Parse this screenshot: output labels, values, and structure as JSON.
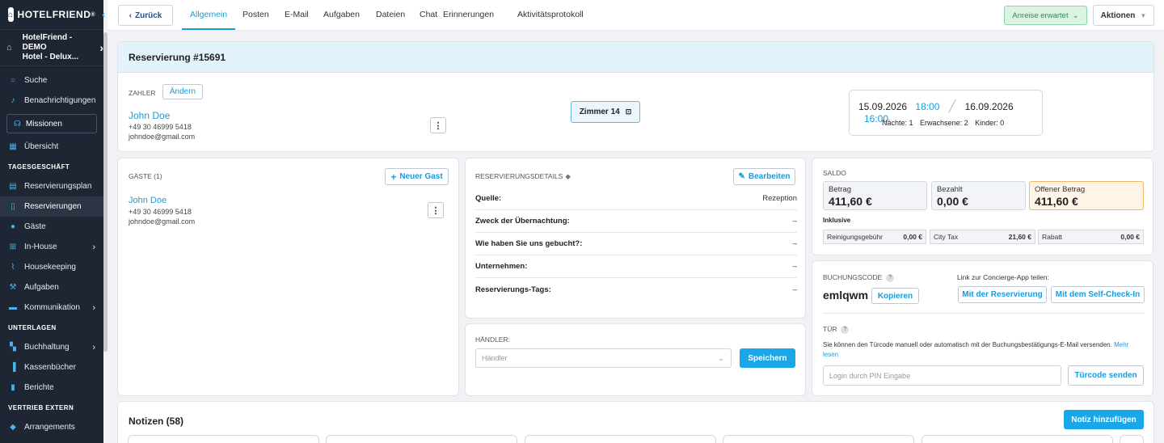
{
  "sidebar": {
    "brand": "HOTELFRIEND",
    "hotel_line1": "HotelFriend - DEMO",
    "hotel_line2": "Hotel - Delux...",
    "search": "Suche",
    "notifications": "Benachrichtigungen",
    "missions": "Missionen",
    "overview": "Übersicht",
    "section_daily": "TAGESGESCHÄFT",
    "reservation_plan": "Reservierungsplan",
    "reservations": "Reservierungen",
    "guests": "Gäste",
    "in_house": "In-House",
    "housekeeping": "Housekeeping",
    "tasks": "Aufgaben",
    "communication": "Kommunikation",
    "section_docs": "UNTERLAGEN",
    "accounting": "Buchhaltung",
    "cashbooks": "Kassenbücher",
    "reports": "Berichte",
    "section_sales": "VERTRIEB EXTERN",
    "arrangements": "Arrangements"
  },
  "topbar": {
    "back": "Zurück",
    "tabs": [
      "Allgemein",
      "Posten",
      "E-Mail",
      "Aufgaben",
      "Dateien",
      "Chat",
      "Erinnerungen",
      "Aktivitätsprotokoll"
    ],
    "status": "Anreise erwartet",
    "actions": "Aktionen"
  },
  "reservation": {
    "title": "Reservierung #15691",
    "payer_label": "ZAHLER",
    "change": "Ändern",
    "payer_name": "John Doe",
    "payer_phone": "+49 30 46999 5418",
    "payer_email": "johndoe@gmail.com",
    "room": "Zimmer 14",
    "arrival_date": "15.09.2026",
    "arrival_time": "18:00",
    "departure_date": "16.09.2026",
    "departure_time": "16:00",
    "nights": "Nächte: 1",
    "adults": "Erwachsene: 2",
    "children": "Kinder: 0"
  },
  "guests": {
    "label": "GÄSTE (1)",
    "new_guest": "Neuer Gast",
    "name": "John Doe",
    "phone": "+49 30 46999 5418",
    "email": "johndoe@gmail.com"
  },
  "details": {
    "label": "RESERVIERUNGSDETAILS",
    "edit": "Bearbeiten",
    "rows": [
      {
        "k": "Quelle:",
        "v": "Rezeption"
      },
      {
        "k": "Zweck der Übernachtung:",
        "v": "–"
      },
      {
        "k": "Wie haben Sie uns gebucht?:",
        "v": "–"
      },
      {
        "k": "Unternehmen:",
        "v": "–"
      },
      {
        "k": "Reservierungs-Tags:",
        "v": "–"
      }
    ]
  },
  "dealer": {
    "label": "HÄNDLER:",
    "placeholder": "Händler",
    "save": "Speichern"
  },
  "balance": {
    "label": "SALDO",
    "amount_label": "Betrag",
    "amount": "411,60 €",
    "paid_label": "Bezahlt",
    "paid": "0,00 €",
    "open_label": "Offener Betrag",
    "open": "411,60 €",
    "inclusive": "Inklusive",
    "fees": [
      {
        "name": "Reinigungsgebühr",
        "value": "0,00 €"
      },
      {
        "name": "City Tax",
        "value": "21,60 €"
      },
      {
        "name": "Rabatt",
        "value": "0,00 €"
      }
    ]
  },
  "booking": {
    "label": "BUCHUNGSCODE",
    "code": "emlqwm",
    "copy": "Kopieren",
    "share_label": "Link zur Concierge-App teilen:",
    "with_reservation": "Mit der Reservierung",
    "with_selfcheckin": "Mit dem Self-Check-In",
    "door_label": "TÜR",
    "door_text": "Sie können den Türcode manuell oder automatisch mit der Buchungsbestätigungs-E-Mail versenden.",
    "more": "Mehr lesen",
    "pin_placeholder": "Login durch PIN Eingabe",
    "send_code": "Türcode senden"
  },
  "notes": {
    "title": "Notizen (58)",
    "add": "Notiz hinzufügen"
  },
  "colors": {
    "accent": "#1aa7e8",
    "sidebar_bg": "#1e2633",
    "header_bg": "#e3f3fb",
    "status_bg": "#dbf3e5"
  }
}
